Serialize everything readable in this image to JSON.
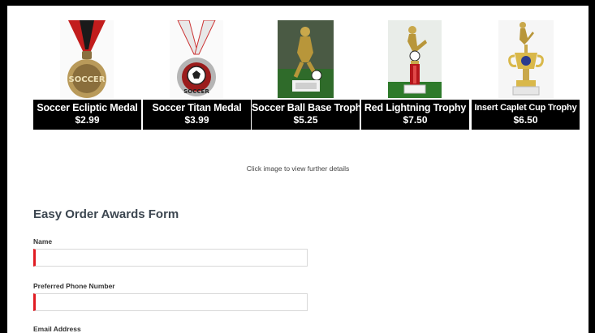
{
  "products": [
    {
      "name": "Soccer Ecliptic Medal",
      "price": "$2.99",
      "icon": "medal-icon"
    },
    {
      "name": "Soccer Titan Medal",
      "price": "$3.99",
      "icon": "medal-icon"
    },
    {
      "name": "Soccer Ball Base Trophy",
      "price": "$5.25",
      "icon": "trophy-icon"
    },
    {
      "name": "Red Lightning Trophy",
      "price": "$7.50",
      "icon": "trophy-icon"
    },
    {
      "name": "Insert Caplet Cup Trophy",
      "price": "$6.50",
      "icon": "trophy-icon"
    }
  ],
  "hint": "Click image to view further details",
  "form": {
    "title": "Easy Order Awards Form",
    "fields": [
      {
        "label": "Name",
        "value": ""
      },
      {
        "label": "Preferred Phone Number",
        "value": ""
      },
      {
        "label": "Email Address"
      }
    ]
  },
  "colors": {
    "required_marker": "#e01b22",
    "caption_bg": "#000000"
  }
}
